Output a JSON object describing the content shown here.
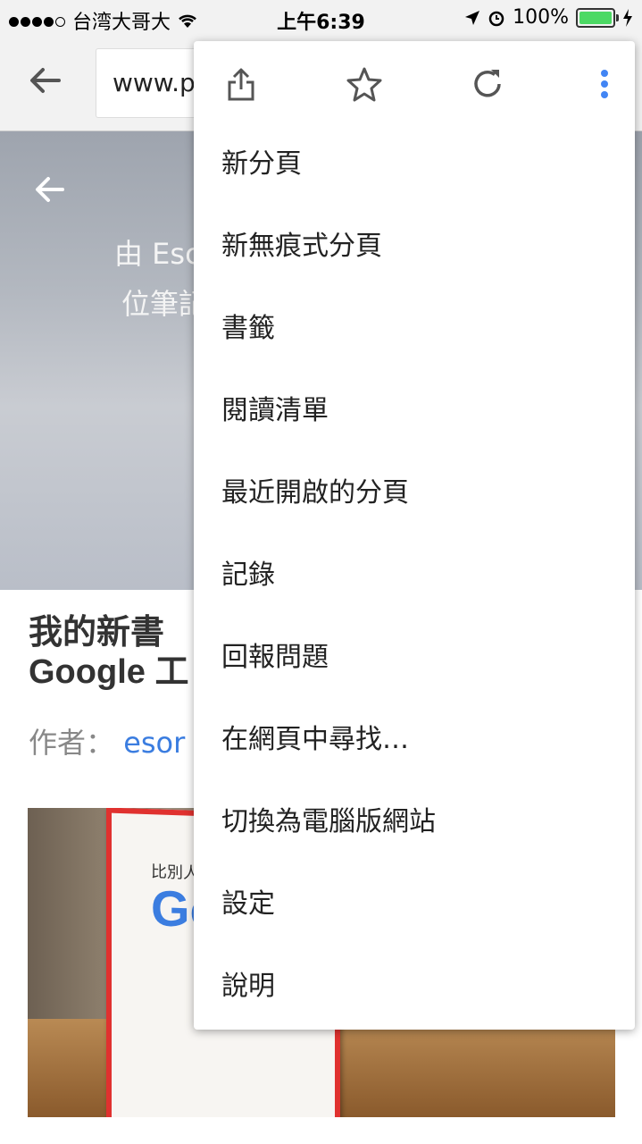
{
  "status_bar": {
    "carrier": "台湾大哥大",
    "time": "上午6:39",
    "battery": "100%",
    "signal_icon": "signal-dots-icon",
    "wifi_icon": "wifi-icon",
    "location_icon": "location-arrow-icon",
    "alarm_icon": "alarm-clock-icon",
    "charging_icon": "charging-bolt-icon"
  },
  "toolbar": {
    "back_icon": "back-arrow-icon",
    "url": "www.p"
  },
  "hero": {
    "line1": "由 Esc",
    "line2": "位筆記"
  },
  "article": {
    "title_line1": "我的新書",
    "title_line2": "Google 工",
    "author_label": "作者：",
    "author_name": "esor"
  },
  "photo": {
    "book_title": "比別人",
    "book_google": "Go"
  },
  "menu": {
    "icons": [
      "share-icon",
      "star-icon",
      "reload-icon",
      "more-vert-icon"
    ],
    "items": [
      "新分頁",
      "新無痕式分頁",
      "書籤",
      "閱讀清單",
      "最近開啟的分頁",
      "記錄",
      "回報問題",
      "在網頁中尋找…",
      "切換為電腦版網站",
      "設定",
      "說明"
    ]
  },
  "colors": {
    "accent": "#4285f4",
    "battery": "#4cd964",
    "author_link": "#3b7de0"
  }
}
